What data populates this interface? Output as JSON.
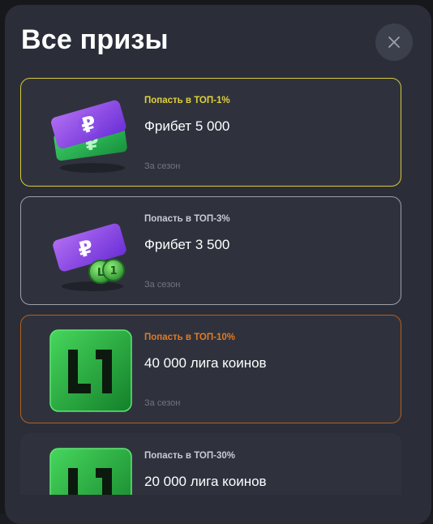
{
  "modal": {
    "title": "Все призы",
    "close_icon": "close-icon"
  },
  "prizes": [
    {
      "condition": "Попасть в ТОП-1%",
      "name": "Фрибет 5 000",
      "period": "За сезон",
      "icon": "freebet-tickets-icon",
      "accent": "#d8c93a"
    },
    {
      "condition": "Попасть в ТОП-3%",
      "name": "Фрибет 3 500",
      "period": "За сезон",
      "icon": "freebet-ticket-coin-icon",
      "accent": "#9aa0aa"
    },
    {
      "condition": "Попасть в ТОП-10%",
      "name": "40 000 лига коинов",
      "period": "За сезон",
      "icon": "liga-coin-logo-icon",
      "accent": "#b5601c"
    },
    {
      "condition": "Попасть в ТОП-30%",
      "name": "20 000 лига коинов",
      "period": "",
      "icon": "liga-coin-logo-icon",
      "accent": "#2f323d"
    }
  ]
}
